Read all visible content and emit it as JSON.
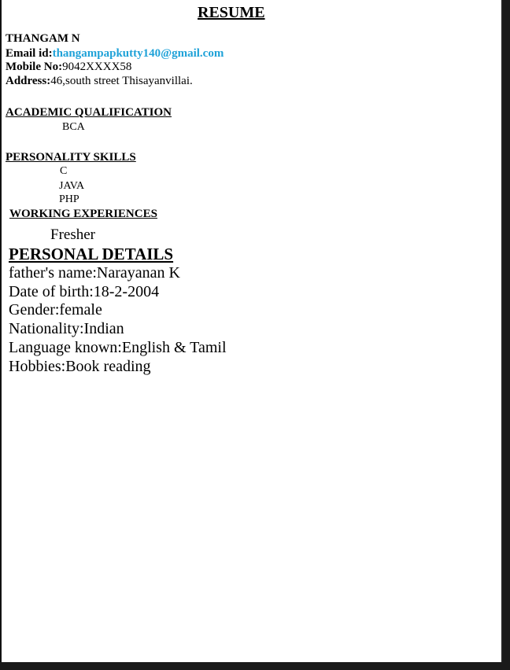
{
  "resume": {
    "title": "RESUME",
    "name": "THANGAM N",
    "email_label": "Email id:",
    "email_value": "thangampapkutty140@gmail.com",
    "mobile_label": "Mobile No:",
    "mobile_value": "9042XXXX58",
    "address_label": "Address:",
    "address_value": "46,south street Thisayanvillai."
  },
  "academic": {
    "heading": "ACADEMIC QUALIFICATION",
    "items": [
      "BCA"
    ]
  },
  "skills": {
    "heading": "PERSONALITY SKILLS",
    "items": [
      "C",
      "JAVA",
      "PHP"
    ]
  },
  "work": {
    "heading": "WORKING EXPERIENCES",
    "value": "Fresher"
  },
  "personal": {
    "heading": "PERSONAL DETAILS",
    "lines": [
      "father's name:Narayanan K",
      "Date of birth:18-2-2004",
      "Gender:female",
      "Nationality:Indian",
      "Language known:English & Tamil",
      "Hobbies:Book reading"
    ]
  }
}
